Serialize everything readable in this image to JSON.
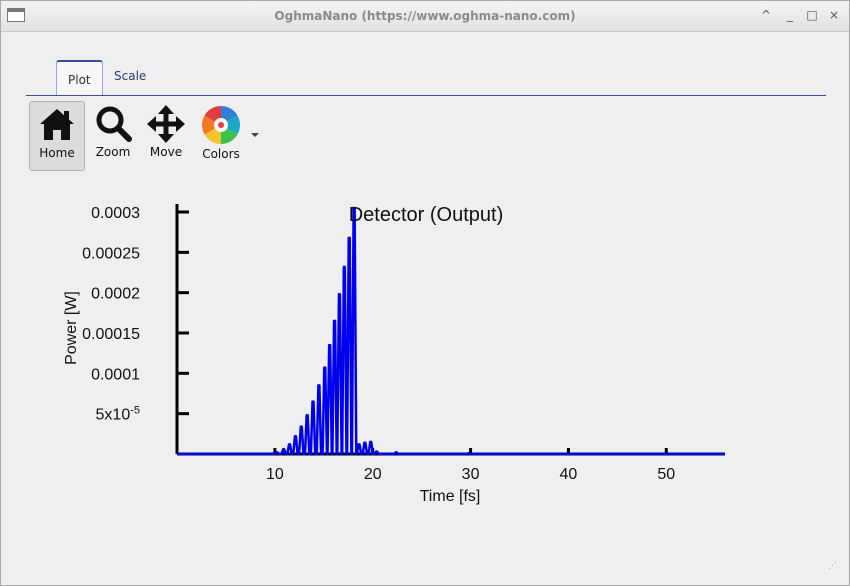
{
  "window": {
    "title": "OghmaNano (https://www.oghma-nano.com)",
    "controls": [
      "^",
      "_",
      "□",
      "×"
    ]
  },
  "tabs": [
    {
      "label": "Plot",
      "active": true
    },
    {
      "label": "Scale",
      "active": false
    }
  ],
  "toolbar": {
    "home_label": "Home",
    "zoom_label": "Zoom",
    "move_label": "Move",
    "colors_label": "Colors"
  },
  "chart_data": {
    "type": "line",
    "title": "Detector (Output)",
    "xlabel": "Time [fs]",
    "ylabel": "Power [W]",
    "xlim": [
      0,
      56
    ],
    "ylim": [
      0,
      0.0003
    ],
    "x_ticks": [
      10,
      20,
      30,
      40,
      50
    ],
    "y_ticks": [
      {
        "value": 5e-05,
        "label": "5x10",
        "sup": "-5"
      },
      {
        "value": 0.0001,
        "label": "0.0001"
      },
      {
        "value": 0.00015,
        "label": "0.00015"
      },
      {
        "value": 0.0002,
        "label": "0.0002"
      },
      {
        "value": 0.00025,
        "label": "0.00025"
      },
      {
        "value": 0.0003,
        "label": "0.0003"
      }
    ],
    "series_color": "#0000ee",
    "pulse_peaks": [
      [
        10.2,
        2e-06
      ],
      [
        10.9,
        6e-06
      ],
      [
        11.5,
        1.2e-05
      ],
      [
        12.1,
        2.2e-05
      ],
      [
        12.7,
        3.4e-05
      ],
      [
        13.3,
        4.8e-05
      ],
      [
        13.9,
        6.5e-05
      ],
      [
        14.5,
        8.5e-05
      ],
      [
        15.1,
        0.000107
      ],
      [
        15.6,
        0.000135
      ],
      [
        16.1,
        0.000165
      ],
      [
        16.6,
        0.000198
      ],
      [
        17.1,
        0.000232
      ],
      [
        17.6,
        0.000268
      ],
      [
        18.1,
        0.000305
      ],
      [
        18.6,
        1.2e-05
      ],
      [
        19.2,
        1.4e-05
      ],
      [
        19.8,
        1.5e-05
      ],
      [
        20.4,
        3e-06
      ],
      [
        22.4,
        2e-06
      ],
      [
        29.8,
        1e-06
      ]
    ]
  }
}
